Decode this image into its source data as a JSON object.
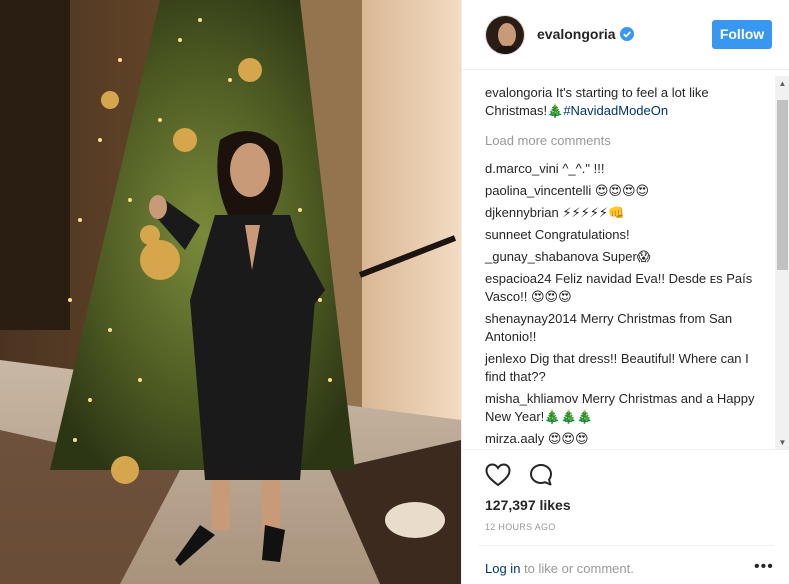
{
  "post": {
    "author": "evalongoria",
    "follow_label": "Follow",
    "caption_user": "evalongoria",
    "caption_text": "It's starting to feel a lot like Christmas!🎄",
    "caption_hashtag": "#NavidadModeOn",
    "load_more": "Load more comments",
    "likes": "127,397 likes",
    "timestamp": "12 HOURS AGO",
    "login_link": "Log in",
    "login_rest": " to like or comment."
  },
  "comments": [
    {
      "user": "d.marco_vini",
      "text": "^_^.\" !!!"
    },
    {
      "user": "paolina_vincentelli",
      "text": "😍😍😍😍"
    },
    {
      "user": "djkennybrian",
      "text": "⚡⚡⚡⚡⚡👊"
    },
    {
      "user": "sunneet",
      "text": "Congratulations!"
    },
    {
      "user": "_gunay_shabanova",
      "text": "Super😱"
    },
    {
      "user": "espacioa24",
      "text": "Feliz navidad Eva!! Desde ᴇs País Vasco!! 😍😍😍"
    },
    {
      "user": "shenaynay2014",
      "text": "Merry Christmas from San Antonio!!"
    },
    {
      "user": "jenlexo",
      "text": "Dig that dress!! Beautiful! Where can I find that??"
    },
    {
      "user": "misha_khliamov",
      "text": "Merry Christmas and a Happy New Year!🎄🎄🎄"
    },
    {
      "user": "mirza.aaly",
      "text": "😍😍😍"
    }
  ],
  "icons": {
    "verified": "verified-badge-icon",
    "like": "heart-icon",
    "comment": "comment-bubble-icon",
    "more": "more-options-icon"
  },
  "colors": {
    "follow_button": "#3897f0",
    "link": "#003569",
    "muted": "#999999"
  }
}
